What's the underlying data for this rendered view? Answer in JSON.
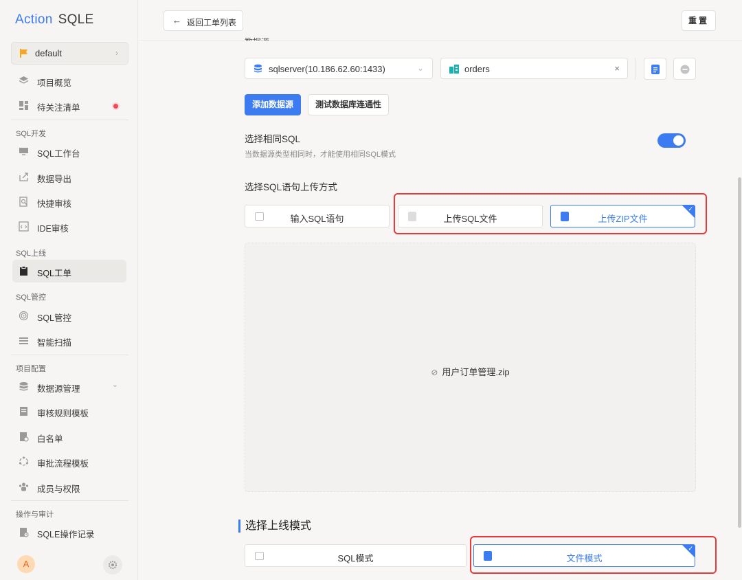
{
  "app": {
    "logo_action": "Action",
    "logo_sqle": "SQLE"
  },
  "sidebar": {
    "project": "default",
    "items_top": [
      {
        "label": "项目概览",
        "icon": "layers-icon"
      },
      {
        "label": "待关注清单",
        "icon": "dashboard-icon"
      }
    ],
    "groups": [
      {
        "title": "SQL开发",
        "items": [
          {
            "label": "SQL工作台",
            "icon": "monitor-icon"
          },
          {
            "label": "数据导出",
            "icon": "export-icon"
          },
          {
            "label": "快捷审核",
            "icon": "search-doc-icon"
          },
          {
            "label": "IDE审核",
            "icon": "ide-icon"
          }
        ]
      },
      {
        "title": "SQL上线",
        "items": [
          {
            "label": "SQL工单",
            "icon": "clipboard-icon"
          }
        ]
      },
      {
        "title": "SQL管控",
        "items": [
          {
            "label": "SQL管控",
            "icon": "fingerprint-icon"
          },
          {
            "label": "智能扫描",
            "icon": "scan-icon"
          }
        ]
      },
      {
        "title": "项目配置",
        "items": [
          {
            "label": "数据源管理",
            "icon": "database-icon"
          },
          {
            "label": "审核规则模板",
            "icon": "rule-icon"
          },
          {
            "label": "白名单",
            "icon": "whitelist-icon"
          },
          {
            "label": "审批流程模板",
            "icon": "flow-icon"
          },
          {
            "label": "成员与权限",
            "icon": "members-icon"
          }
        ]
      },
      {
        "title": "操作与审计",
        "items": [
          {
            "label": "SQLE操作记录",
            "icon": "audit-icon"
          }
        ]
      }
    ],
    "avatar": "A"
  },
  "topbar": {
    "back_label": "返回工单列表",
    "reset_label": "重置"
  },
  "form": {
    "datasource_label": "数据源",
    "datasource_value": "sqlserver(10.186.62.60:1433)",
    "schema_value": "orders",
    "add_datasource": "添加数据源",
    "test_connection": "测试数据库连通性",
    "same_sql_label": "选择相同SQL",
    "same_sql_hint": "当数据源类型相同时，才能使用相同SQL模式",
    "same_sql_enabled": true,
    "upload_method_label": "选择SQL语句上传方式",
    "upload_options": [
      "输入SQL语句",
      "上传SQL文件",
      "上传ZIP文件"
    ],
    "upload_selected": "上传ZIP文件",
    "uploaded_file": "用户订单管理.zip",
    "exec_mode_title": "选择上线模式",
    "exec_modes": [
      "SQL模式",
      "文件模式"
    ],
    "exec_mode_selected": "文件模式"
  },
  "colors": {
    "accent": "#3d7cf0",
    "highlight": "#e8383d"
  }
}
